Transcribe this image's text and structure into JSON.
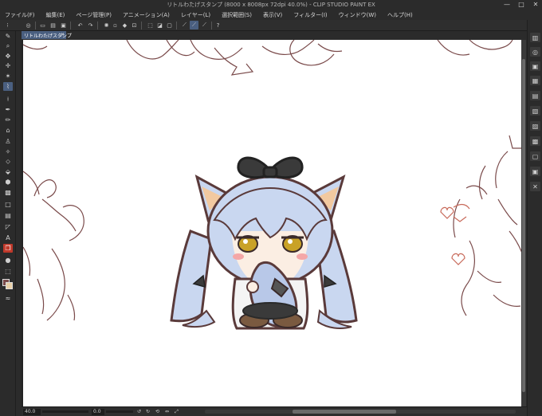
{
  "window": {
    "title": "リトルわたげスタンプ (8000 x 8008px 72dpi 40.0%) - CLIP STUDIO PAINT EX",
    "controls": [
      "—",
      "□",
      "✕"
    ]
  },
  "menu": [
    "ファイル(F)",
    "編集(E)",
    "ページ管理(P)",
    "アニメーション(A)",
    "レイヤー(L)",
    "選択範囲(S)",
    "表示(V)",
    "フィルター(I)",
    "ウィンドウ(W)",
    "ヘルプ(H)"
  ],
  "document_tab": {
    "label": "リトルわたげスタンプ",
    "close": "×"
  },
  "status": {
    "zoom": "40.0",
    "rotation": "0.0"
  },
  "colors": {
    "accent": "#4a5f80",
    "line_art": "#7a4a4a",
    "hair": "#c9d7f0",
    "outline": "#5a3a3a",
    "ribbon": "#3a3a3a",
    "eyes": "#c9a227",
    "tool_red": "#c0392b"
  },
  "icons": {
    "toolbar": [
      "brush-size-icon",
      "zoom-icon",
      "move-hand-icon",
      "object-icon",
      "sparkle-icon",
      "lasso-select-icon",
      "eyedropper-icon",
      "pen-icon",
      "pencil-icon",
      "brush-icon",
      "airbrush-icon",
      "decoration-icon",
      "eraser-icon",
      "blend-icon",
      "fill-icon",
      "gradient-icon",
      "figure-icon",
      "frame-icon",
      "ruler-icon",
      "text-icon",
      "balloon-icon",
      "correction-icon",
      "color-swatch-icon"
    ],
    "right_dock": [
      "layer-panel-icon",
      "navigator-icon",
      "subview-icon",
      "material-icon",
      "history-icon",
      "layer-property-icon",
      "tool-property-icon",
      "timeline-icon",
      "auto-action-icon",
      "color-set-icon",
      "close-panel-icon"
    ]
  }
}
